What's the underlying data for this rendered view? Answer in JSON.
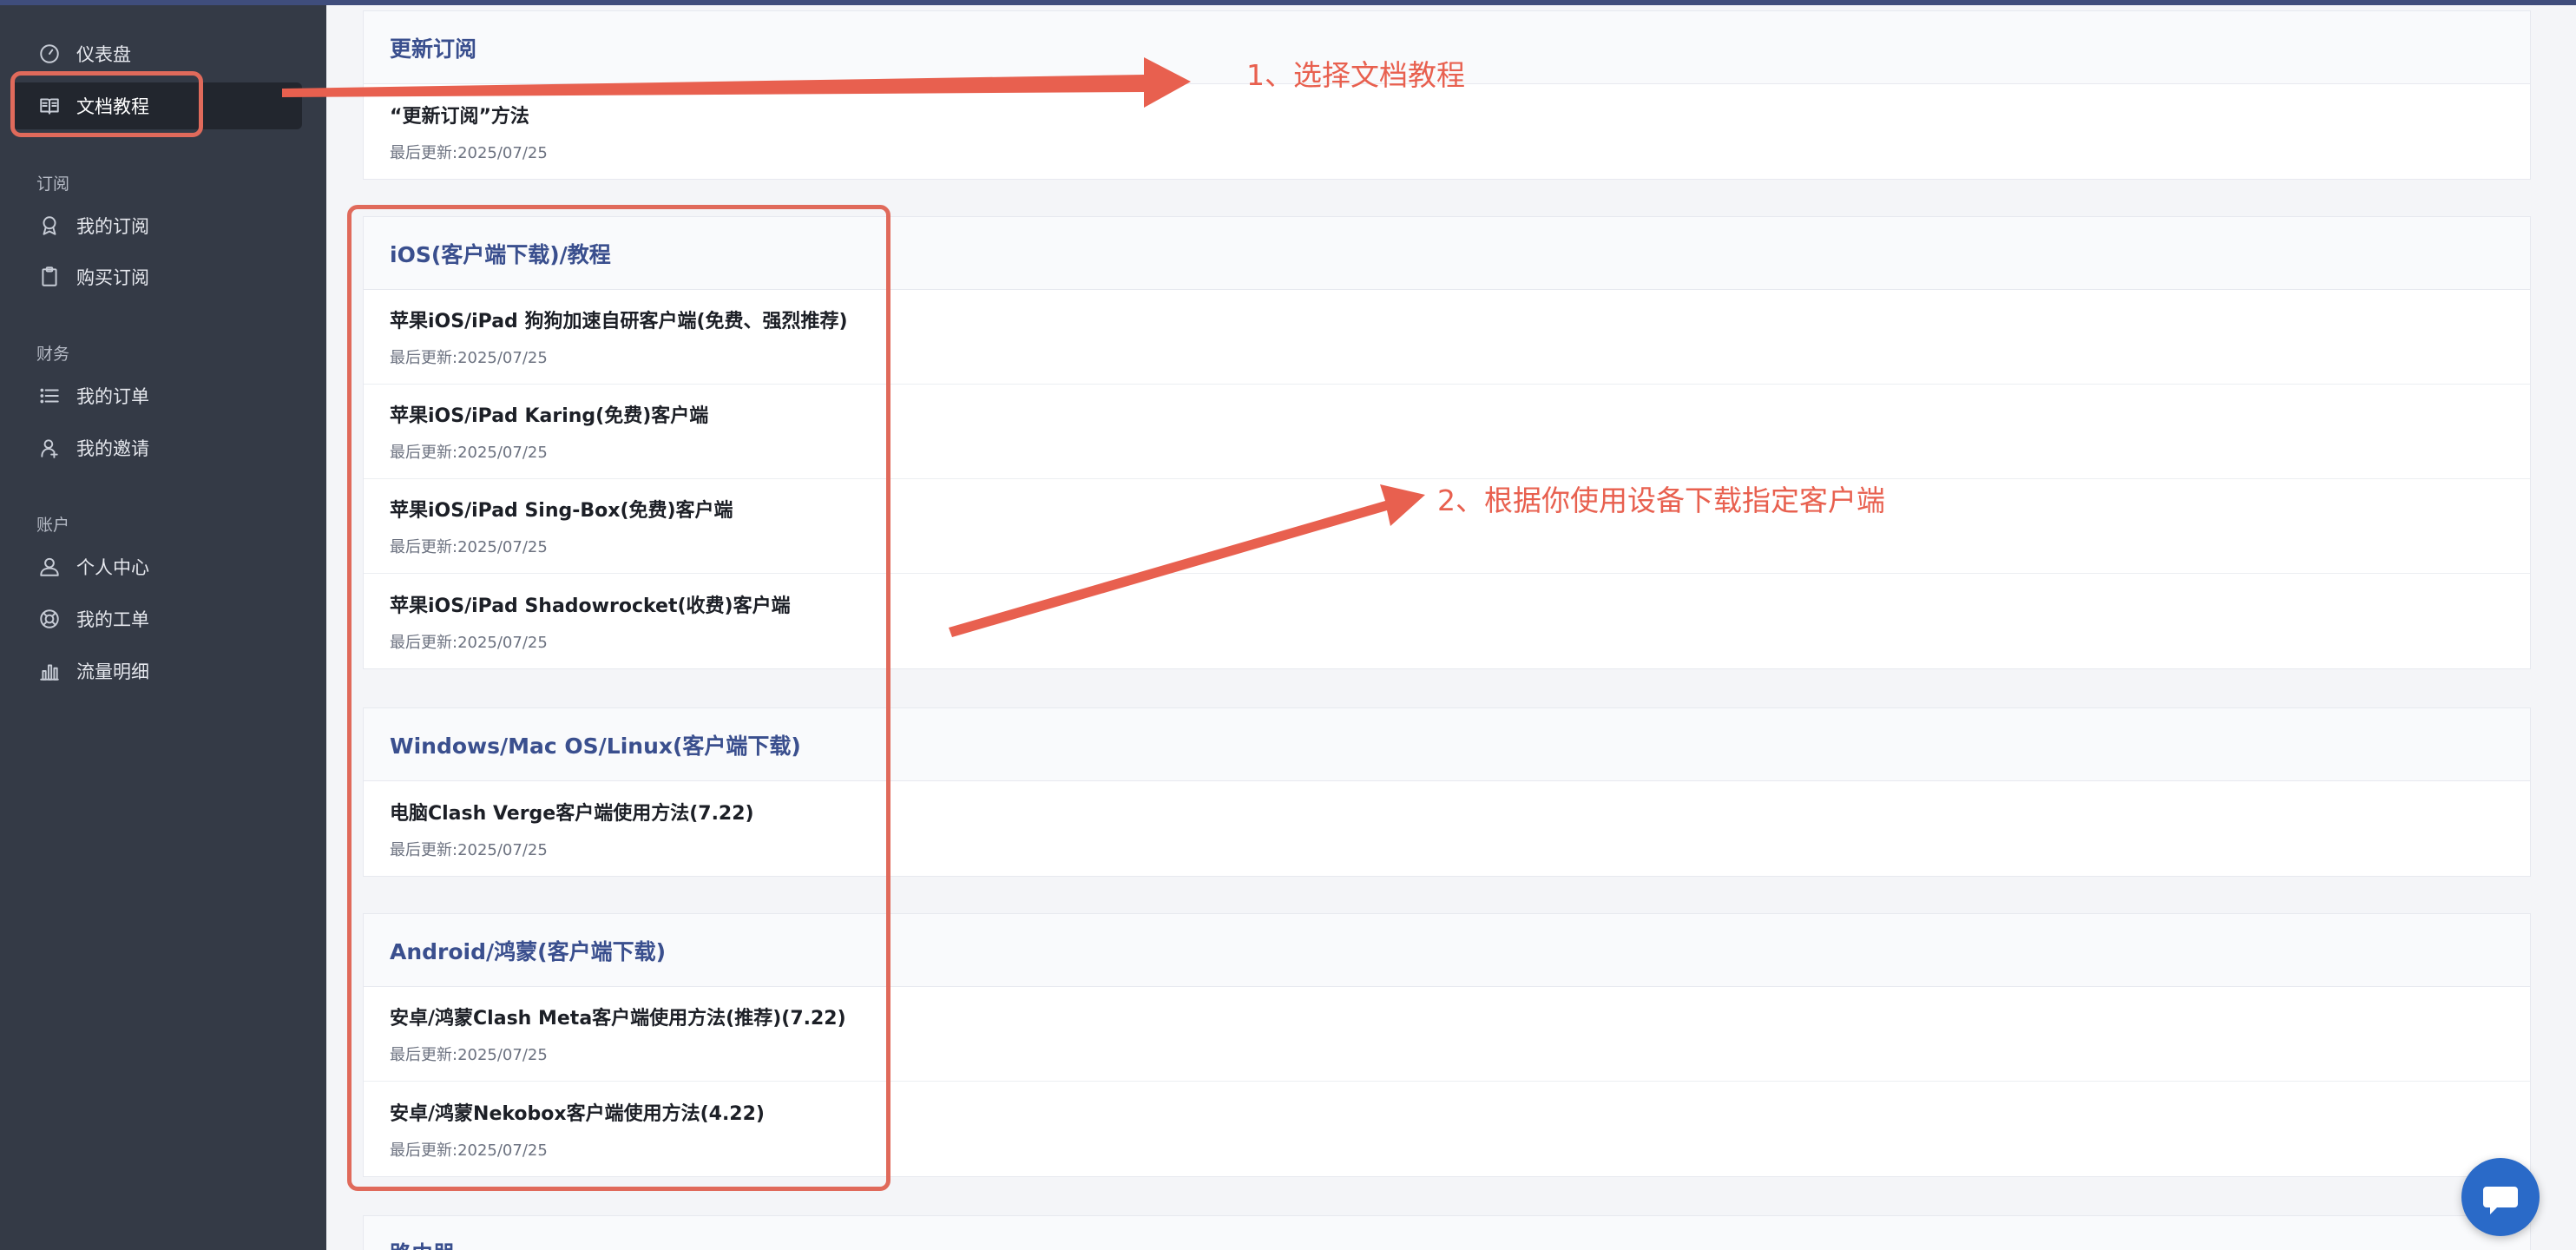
{
  "sidebar": {
    "items": [
      {
        "label": "仪表盘",
        "icon": "dashboard-icon"
      },
      {
        "label": "文档教程",
        "icon": "book-icon",
        "active": true
      },
      {
        "label": "我的订阅",
        "icon": "subscription-icon"
      },
      {
        "label": "购买订阅",
        "icon": "clipboard-icon"
      },
      {
        "label": "我的订单",
        "icon": "list-icon"
      },
      {
        "label": "我的邀请",
        "icon": "invite-icon"
      },
      {
        "label": "个人中心",
        "icon": "user-icon"
      },
      {
        "label": "我的工单",
        "icon": "support-icon"
      },
      {
        "label": "流量明细",
        "icon": "bar-chart-icon"
      }
    ],
    "sections": [
      "订阅",
      "财务",
      "账户"
    ]
  },
  "main": {
    "categories": [
      {
        "title": "更新订阅",
        "docs": [
          {
            "title": "“更新订阅”方法",
            "date": "最后更新:2025/07/25"
          }
        ]
      },
      {
        "title": "iOS(客户端下载)/教程",
        "docs": [
          {
            "title": "苹果iOS/iPad 狗狗加速自研客户端(免费、强烈推荐)",
            "date": "最后更新:2025/07/25"
          },
          {
            "title": "苹果iOS/iPad Karing(免费)客户端",
            "date": "最后更新:2025/07/25"
          },
          {
            "title": "苹果iOS/iPad Sing-Box(免费)客户端",
            "date": "最后更新:2025/07/25"
          },
          {
            "title": "苹果iOS/iPad Shadowrocket(收费)客户端",
            "date": "最后更新:2025/07/25"
          }
        ]
      },
      {
        "title": "Windows/Mac OS/Linux(客户端下载)",
        "docs": [
          {
            "title": "电脑Clash Verge客户端使用方法(7.22)",
            "date": "最后更新:2025/07/25"
          }
        ]
      },
      {
        "title": "Android/鸿蒙(客户端下载)",
        "docs": [
          {
            "title": "安卓/鸿蒙Clash Meta客户端使用方法(推荐)(7.22)",
            "date": "最后更新:2025/07/25"
          },
          {
            "title": "安卓/鸿蒙Nekobox客户端使用方法(4.22)",
            "date": "最后更新:2025/07/25"
          }
        ]
      },
      {
        "title": "路由器",
        "docs": []
      }
    ]
  },
  "annotations": {
    "step1": "1、选择文档教程",
    "step2": "2、根据你使用设备下载指定客户端",
    "color": "#e8604f"
  },
  "chat": {
    "icon": "chat-bubble-icon"
  }
}
